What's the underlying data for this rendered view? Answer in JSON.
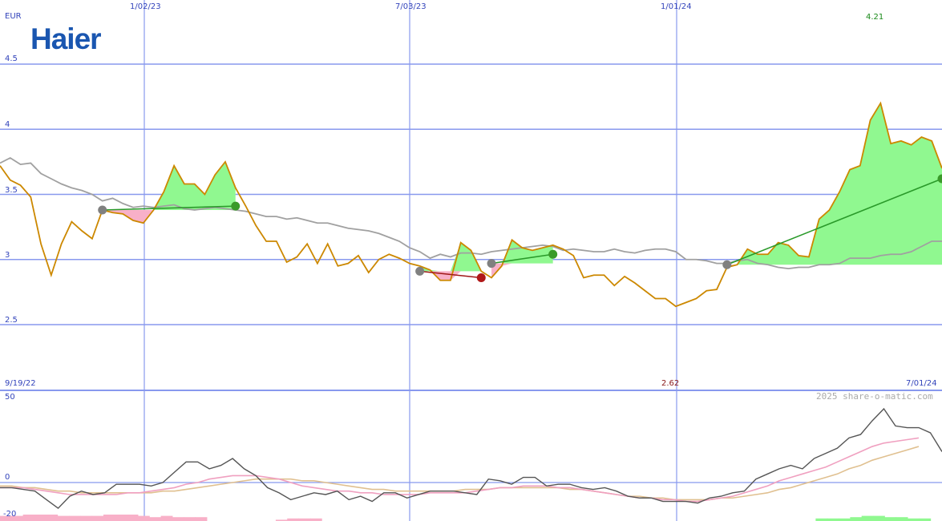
{
  "logo": {
    "text": "Haier",
    "color": "#1a56b0"
  },
  "colors": {
    "grid": "#8899ee",
    "price": "#cc8800",
    "ma_grey": "#a0a0a0",
    "fill_green": "#90f890",
    "fill_pink": "#f8b0c8",
    "trend_green": "#2a9a2a",
    "trend_red": "#a01818",
    "label_blue": "#3344bb",
    "max_green": "#1a8a1a",
    "min_red": "#8a1a1a",
    "osc_dark": "#555555",
    "osc_pink": "#f0a0c0",
    "osc_tan": "#e0c090"
  },
  "chart_data": [
    {
      "type": "line",
      "currency": "EUR",
      "ylim": [
        2.5,
        4.5
      ],
      "yticks": [
        "4.5",
        "4",
        "3.5",
        "3",
        "2.5"
      ],
      "xticks": [
        "1/02/23",
        "7/03/23",
        "1/01/24"
      ],
      "date_start": "9/19/22",
      "date_end": "7/01/24",
      "max_label": "4.21",
      "min_label": "2.62",
      "grid": true,
      "series": [
        {
          "name": "",
          "values": [
            3.72,
            3.61,
            3.57,
            3.48,
            3.12,
            2.88,
            3.12,
            3.29,
            3.22,
            3.16,
            3.38,
            3.36,
            3.35,
            3.3,
            3.28,
            3.38,
            3.52,
            3.72,
            3.58,
            3.58,
            3.5,
            3.65,
            3.75,
            3.55,
            3.41,
            3.26,
            3.14,
            3.14,
            2.98,
            3.02,
            3.12,
            2.97,
            3.12,
            2.95,
            2.97,
            3.03,
            2.9,
            3.0,
            3.04,
            3.01,
            2.97,
            2.95,
            2.92,
            2.84,
            2.84,
            3.13,
            3.07,
            2.91,
            2.86,
            2.95,
            3.15,
            3.09,
            3.07,
            3.09,
            3.11,
            3.08,
            3.03,
            2.86,
            2.88,
            2.88,
            2.8,
            2.87,
            2.82,
            2.76,
            2.7,
            2.7,
            2.64,
            2.67,
            2.7,
            2.76,
            2.77,
            2.94,
            2.96,
            3.08,
            3.04,
            3.04,
            3.13,
            3.11,
            3.03,
            3.02,
            3.31,
            3.38,
            3.52,
            3.69,
            3.72,
            4.07,
            4.2,
            3.89,
            3.91,
            3.88,
            3.94,
            3.91,
            3.7
          ]
        },
        {
          "name": "",
          "values": [
            3.74,
            3.78,
            3.73,
            3.74,
            3.66,
            3.62,
            3.58,
            3.55,
            3.53,
            3.5,
            3.45,
            3.47,
            3.43,
            3.4,
            3.41,
            3.4,
            3.41,
            3.42,
            3.39,
            3.38,
            3.39,
            3.4,
            3.39,
            3.38,
            3.37,
            3.35,
            3.33,
            3.33,
            3.31,
            3.32,
            3.3,
            3.28,
            3.28,
            3.26,
            3.24,
            3.23,
            3.22,
            3.2,
            3.17,
            3.14,
            3.09,
            3.06,
            3.01,
            3.04,
            3.02,
            3.05,
            3.05,
            3.04,
            3.06,
            3.07,
            3.08,
            3.09,
            3.1,
            3.11,
            3.1,
            3.07,
            3.08,
            3.07,
            3.06,
            3.06,
            3.08,
            3.06,
            3.05,
            3.07,
            3.08,
            3.08,
            3.06,
            3.0,
            3.0,
            2.99,
            2.97,
            2.97,
            2.99,
            3.0,
            2.97,
            2.96,
            2.94,
            2.93,
            2.94,
            2.94,
            2.96,
            2.96,
            2.97,
            3.01,
            3.01,
            3.01,
            3.03,
            3.04,
            3.04,
            3.06,
            3.1,
            3.14,
            3.14
          ]
        }
      ],
      "trades": [
        {
          "from": [
            10,
            3.38
          ],
          "to": [
            23,
            3.41
          ],
          "result": "gain"
        },
        {
          "from": [
            41,
            2.91
          ],
          "to": [
            47,
            2.86
          ],
          "result": "loss"
        },
        {
          "from": [
            48,
            2.97
          ],
          "to": [
            54,
            3.04
          ],
          "result": "gain"
        },
        {
          "from": [
            71,
            2.96
          ],
          "to": [
            92,
            3.62
          ],
          "result": "gain"
        }
      ]
    },
    {
      "type": "line",
      "ylim": [
        -20,
        50
      ],
      "yticks": [
        "50",
        "0",
        "-20"
      ],
      "watermark": "2025 share-o-matic.com",
      "series": [
        {
          "name": "",
          "values": [
            -3,
            -3,
            -4,
            -5,
            -10,
            -15,
            -8,
            -5,
            -7,
            -6,
            -1,
            -1,
            -1,
            -2,
            0,
            6,
            12,
            12,
            8,
            10,
            14,
            8,
            4,
            -3,
            -6,
            -10,
            -8,
            -6,
            -7,
            -5,
            -10,
            -8,
            -11,
            -6,
            -6,
            -9,
            -7,
            -5,
            -5,
            -5,
            -6,
            -7,
            2,
            1,
            -1,
            3,
            3,
            -2,
            -1,
            -1,
            -3,
            -4,
            -3,
            -5,
            -8,
            -9,
            -9,
            -11,
            -11,
            -11,
            -12,
            -9,
            -8,
            -6,
            -5,
            2,
            5,
            8,
            10,
            8,
            14,
            17,
            20,
            26,
            28,
            36,
            43,
            33,
            32,
            32,
            29,
            18
          ]
        },
        {
          "name": "",
          "values": [
            -3,
            -3,
            -3,
            -4,
            -5,
            -6,
            -7,
            -7,
            -7,
            -7,
            -7,
            -6,
            -6,
            -5,
            -4,
            -3,
            -1,
            0,
            2,
            3,
            4,
            4,
            4,
            3,
            2,
            0,
            -2,
            -3,
            -4,
            -5,
            -5,
            -6,
            -6,
            -7,
            -7,
            -7,
            -7,
            -6,
            -6,
            -6,
            -6,
            -5,
            -4,
            -3,
            -3,
            -2,
            -2,
            -2,
            -3,
            -3,
            -4,
            -5,
            -6,
            -7,
            -8,
            -9,
            -9,
            -10,
            -10,
            -11,
            -11,
            -10,
            -9,
            -8,
            -6,
            -4,
            -2,
            1,
            3,
            5,
            7,
            9,
            12,
            15,
            18,
            21,
            23,
            24,
            25,
            26
          ]
        },
        {
          "name": "",
          "values": [
            -2,
            -2,
            -3,
            -3,
            -4,
            -5,
            -5,
            -6,
            -6,
            -6,
            -6,
            -6,
            -6,
            -6,
            -5,
            -5,
            -4,
            -3,
            -2,
            -1,
            0,
            1,
            2,
            2,
            2,
            2,
            1,
            1,
            0,
            -1,
            -2,
            -3,
            -4,
            -4,
            -5,
            -5,
            -5,
            -5,
            -5,
            -5,
            -4,
            -4,
            -4,
            -3,
            -3,
            -3,
            -3,
            -3,
            -3,
            -4,
            -4,
            -5,
            -6,
            -7,
            -8,
            -8,
            -9,
            -9,
            -10,
            -10,
            -10,
            -10,
            -9,
            -9,
            -8,
            -7,
            -6,
            -4,
            -3,
            -1,
            1,
            3,
            5,
            8,
            10,
            13,
            15,
            17,
            19,
            21
          ]
        }
      ],
      "histogram": [
        -4,
        -4,
        -5,
        -5,
        -5,
        -4,
        -4,
        -4,
        -4,
        -5,
        -5,
        -5,
        -4,
        -3,
        -4,
        -3,
        -3,
        -3,
        0,
        0,
        0,
        0,
        0,
        0,
        -1,
        -2,
        -2,
        -2,
        0,
        0,
        0,
        0,
        0,
        0,
        0,
        0,
        0,
        0,
        0,
        0,
        0,
        0,
        0,
        0,
        0,
        0,
        0,
        0,
        0,
        0,
        0,
        0,
        0,
        0,
        0,
        0,
        0,
        0,
        0,
        0,
        0,
        0,
        0,
        0,
        0,
        0,
        0,
        0,
        0,
        0,
        0,
        2,
        2,
        2,
        3,
        4,
        4,
        3,
        3,
        2,
        2,
        0
      ]
    }
  ]
}
